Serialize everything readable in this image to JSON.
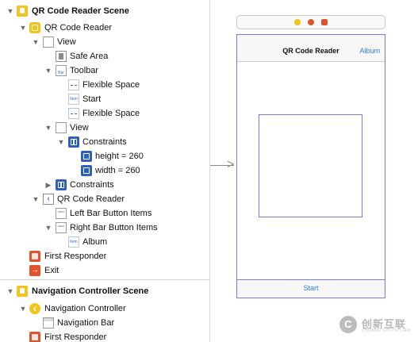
{
  "outline": {
    "rows": [
      {
        "label": "QR Code Reader Scene",
        "icon": "scene-icon",
        "bold": true,
        "disclosure": "open"
      },
      {
        "label": "QR Code Reader",
        "icon": "view-controller-icon",
        "disclosure": "open"
      },
      {
        "label": "View",
        "icon": "view-icon",
        "disclosure": "open"
      },
      {
        "label": "Safe Area",
        "icon": "safe-area-icon"
      },
      {
        "label": "Toolbar",
        "icon": "toolbar-icon",
        "disclosure": "open"
      },
      {
        "label": "Flexible Space",
        "icon": "flexible-space-icon"
      },
      {
        "label": "Start",
        "icon": "bar-button-item-icon"
      },
      {
        "label": "Flexible Space",
        "icon": "flexible-space-icon"
      },
      {
        "label": "View",
        "icon": "view-icon",
        "disclosure": "open"
      },
      {
        "label": "Constraints",
        "icon": "constraints-icon",
        "disclosure": "open"
      },
      {
        "label": "height = 260",
        "icon": "constraint-icon"
      },
      {
        "label": "width = 260",
        "icon": "constraint-icon"
      },
      {
        "label": "Constraints",
        "icon": "constraints-icon",
        "disclosure": "closed"
      },
      {
        "label": "QR Code Reader",
        "icon": "navigation-item-icon",
        "disclosure": "open"
      },
      {
        "label": "Left Bar Button Items",
        "icon": "bar-items-icon"
      },
      {
        "label": "Right Bar Button Items",
        "icon": "bar-items-icon",
        "disclosure": "open"
      },
      {
        "label": "Album",
        "icon": "bar-button-item-icon"
      },
      {
        "label": "First Responder",
        "icon": "first-responder-icon"
      },
      {
        "label": "Exit",
        "icon": "exit-icon"
      },
      {
        "label": "Navigation Controller Scene",
        "icon": "scene-icon",
        "bold": true,
        "disclosure": "open"
      },
      {
        "label": "Navigation Controller",
        "icon": "navigation-controller-icon",
        "disclosure": "open"
      },
      {
        "label": "Navigation Bar",
        "icon": "navigation-bar-icon"
      },
      {
        "label": "First Responder",
        "icon": "first-responder-icon"
      }
    ]
  },
  "canvas": {
    "nav_title": "QR Code Reader",
    "nav_right_button": "Album",
    "toolbar_button": "Start"
  },
  "watermark": {
    "title": "创新互联",
    "subtitle": "CHUANG XIN HU LIAN",
    "mark": "C"
  }
}
